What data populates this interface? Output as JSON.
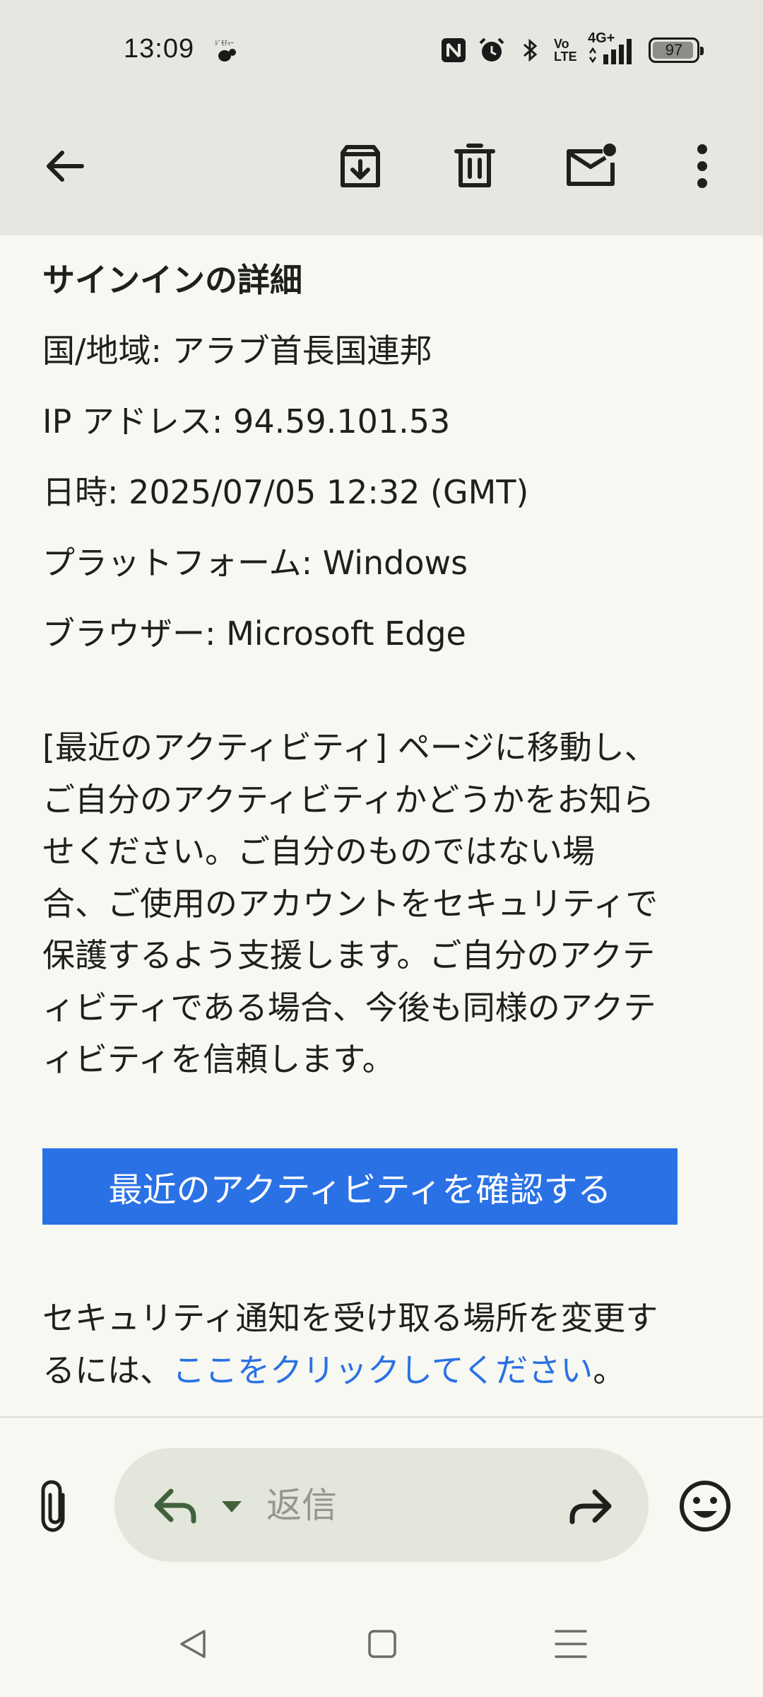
{
  "status_bar": {
    "time": "13:09",
    "volte_label": "Vo\nLTE",
    "network_label": "4G+",
    "battery_level": "97",
    "icons": [
      "notification-app-icon",
      "nfc-icon",
      "alarm-icon",
      "bluetooth-icon",
      "volte-icon",
      "signal-icon",
      "battery-icon"
    ]
  },
  "toolbar": {
    "icons": [
      "back-arrow-icon",
      "archive-icon",
      "delete-icon",
      "mark-unread-icon",
      "more-vert-icon"
    ]
  },
  "email": {
    "heading": "サインインの詳細",
    "details": [
      "国/地域: アラブ首長国連邦",
      "IP アドレス: 94.59.101.53",
      "日時: 2025/07/05 12:32 (GMT)",
      "プラットフォーム: Windows",
      "ブラウザー: Microsoft Edge"
    ],
    "paragraph_lines": [
      "[最近のアクティビティ] ページに移動し、",
      "ご自分のアクティビティかどうかをお知ら",
      "せください。ご自分のものではない場",
      "合、ご使用のアカウントをセキュリティで",
      "保護するよう支援します。ご自分のアクテ",
      "ィビティである場合、今後も同様のアクテ",
      "ィビティを信頼します。"
    ],
    "cta_label": "最近のアクティビティを確認する",
    "footer_line1": "セキュリティ通知を受け取る場所を変更す",
    "footer_line2_prefix": "るには、",
    "footer_link": "ここをクリックしてください",
    "footer_suffix": "。"
  },
  "reply_bar": {
    "placeholder": "返信",
    "icons": [
      "attach-icon",
      "reply-icon",
      "reply-options-caret-icon",
      "forward-icon",
      "emoji-icon"
    ]
  },
  "nav_bar": {
    "icons": [
      "nav-back-icon",
      "nav-home-icon",
      "nav-recents-icon"
    ]
  },
  "colors": {
    "top_bar": "#e6e7e0",
    "background": "#f7f8f1",
    "accent": "#2a71e6",
    "reply_pill": "#e3e6da",
    "reply_green": "#41613a"
  }
}
